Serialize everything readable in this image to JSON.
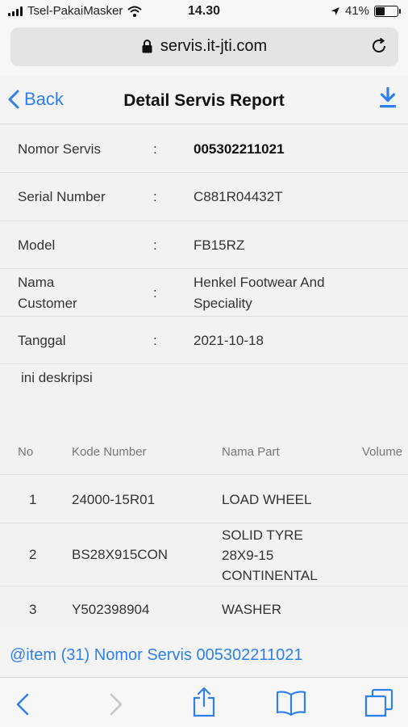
{
  "status": {
    "carrier": "Tsel-PakaiMasker",
    "time": "14.30",
    "battery_percent": "41%",
    "battery_level": 0.41
  },
  "browser": {
    "url": "servis.it-jti.com"
  },
  "nav": {
    "back_label": "Back",
    "title": "Detail Servis Report"
  },
  "details": [
    {
      "label": "Nomor Servis",
      "value": "005302211021"
    },
    {
      "label": "Serial Number",
      "value": "C881R04432T"
    },
    {
      "label": "Model",
      "value": "FB15RZ"
    },
    {
      "label": "Nama Customer",
      "value": "Henkel Footwear And Speciality"
    },
    {
      "label": "Tanggal",
      "value": "2021-10-18"
    }
  ],
  "colon": ":",
  "description": "ini deskripsi",
  "table": {
    "headers": [
      "No",
      "Kode Number",
      "Nama Part",
      "Volume"
    ],
    "rows": [
      {
        "no": "1",
        "kode": "24000-15R01",
        "nama": "LOAD WHEEL"
      },
      {
        "no": "2",
        "kode": "BS28X915CON",
        "nama": "SOLID TYRE 28X9-15 CONTINENTAL"
      },
      {
        "no": "3",
        "kode": "Y502398904",
        "nama": "WASHER"
      }
    ]
  },
  "item_link": "@item (31) Nomor Servis 005302211021"
}
